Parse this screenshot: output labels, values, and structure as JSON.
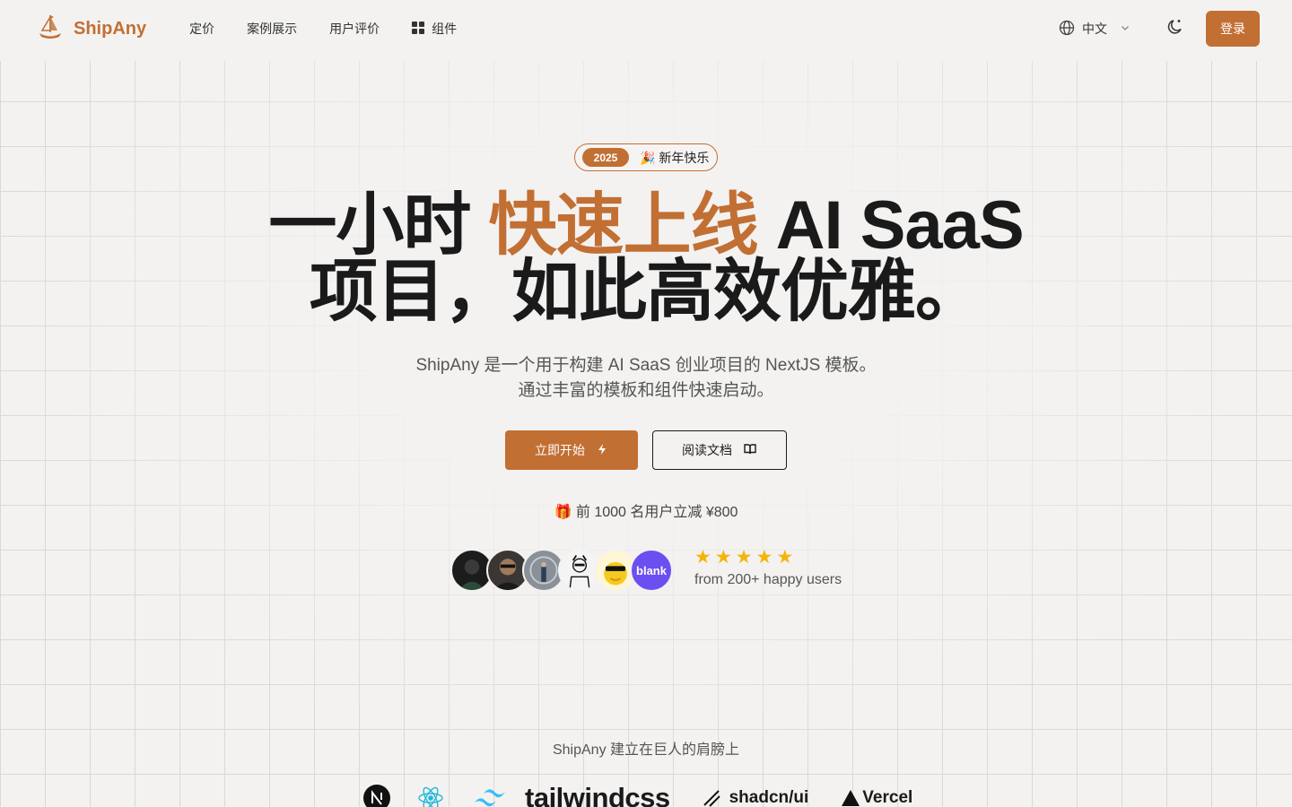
{
  "brand": {
    "name": "ShipAny",
    "accent": "#c26f33"
  },
  "nav": {
    "items": [
      {
        "label": "定价"
      },
      {
        "label": "案例展示"
      },
      {
        "label": "用户评价"
      },
      {
        "label": "组件"
      }
    ]
  },
  "header": {
    "language": "中文",
    "login_label": "登录"
  },
  "badge": {
    "year": "2025",
    "text": "🎉 新年快乐"
  },
  "hero": {
    "title_part1": "一小时 ",
    "title_highlight": "快速上线",
    "title_part2": " AI SaaS",
    "title_line2": "项目，如此高效优雅。",
    "subtitle_line1": "ShipAny 是一个用于构建 AI SaaS 创业项目的 NextJS 模板。",
    "subtitle_line2": "通过丰富的模板和组件快速启动。",
    "primary_button": "立即开始",
    "secondary_button": "阅读文档",
    "promo": "🎁 前 1000 名用户立减 ¥800"
  },
  "social_proof": {
    "rating_stars": 5,
    "avatar_last_label": "blank",
    "text": "from 200+ happy users"
  },
  "built_on": {
    "title": "ShipAny 建立在巨人的肩膀上",
    "logos": {
      "tailwind": "tailwindcss",
      "shadcn": "shadcn/ui",
      "vercel": "Vercel"
    }
  }
}
